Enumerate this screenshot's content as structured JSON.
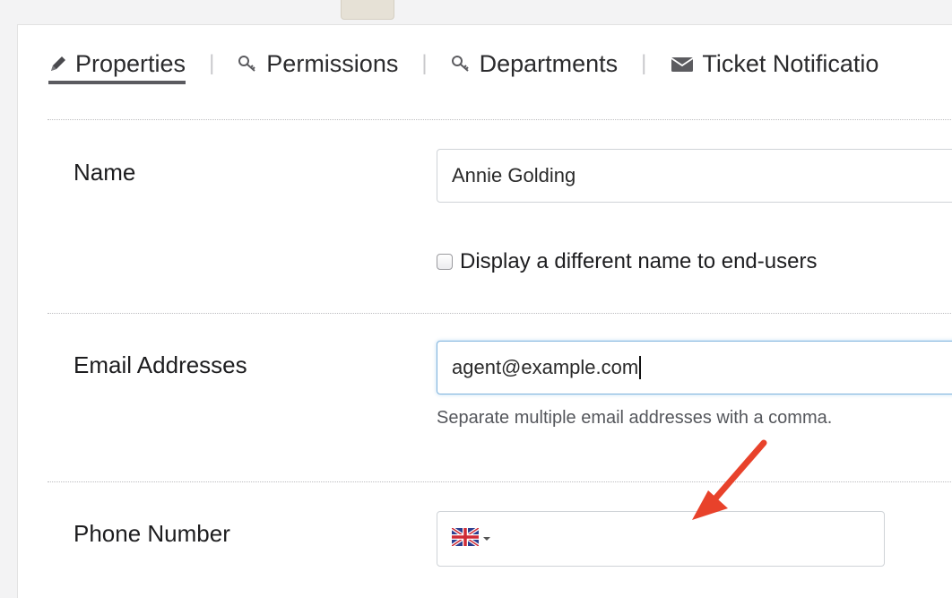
{
  "tabs": [
    {
      "label": "Properties",
      "icon": "pencil-icon",
      "active": true
    },
    {
      "label": "Permissions",
      "icon": "key-icon",
      "active": false
    },
    {
      "label": "Departments",
      "icon": "key-icon",
      "active": false
    },
    {
      "label": "Ticket Notificatio",
      "icon": "envelope-icon",
      "active": false
    }
  ],
  "tab_separator": "|",
  "form": {
    "name": {
      "label": "Name",
      "value": "Annie Golding"
    },
    "display_name_checkbox": {
      "label": "Display a different name to end-users",
      "checked": false
    },
    "email": {
      "label": "Email Addresses",
      "value": "agent@example.com",
      "help": "Separate multiple email addresses with a comma."
    },
    "phone": {
      "label": "Phone Number",
      "country_flag": "uk-flag-icon",
      "value": ""
    }
  },
  "colors": {
    "focus_border": "#7fb3dd",
    "annotation_arrow": "#e8422b",
    "active_tab_underline": "#5b5b60"
  }
}
